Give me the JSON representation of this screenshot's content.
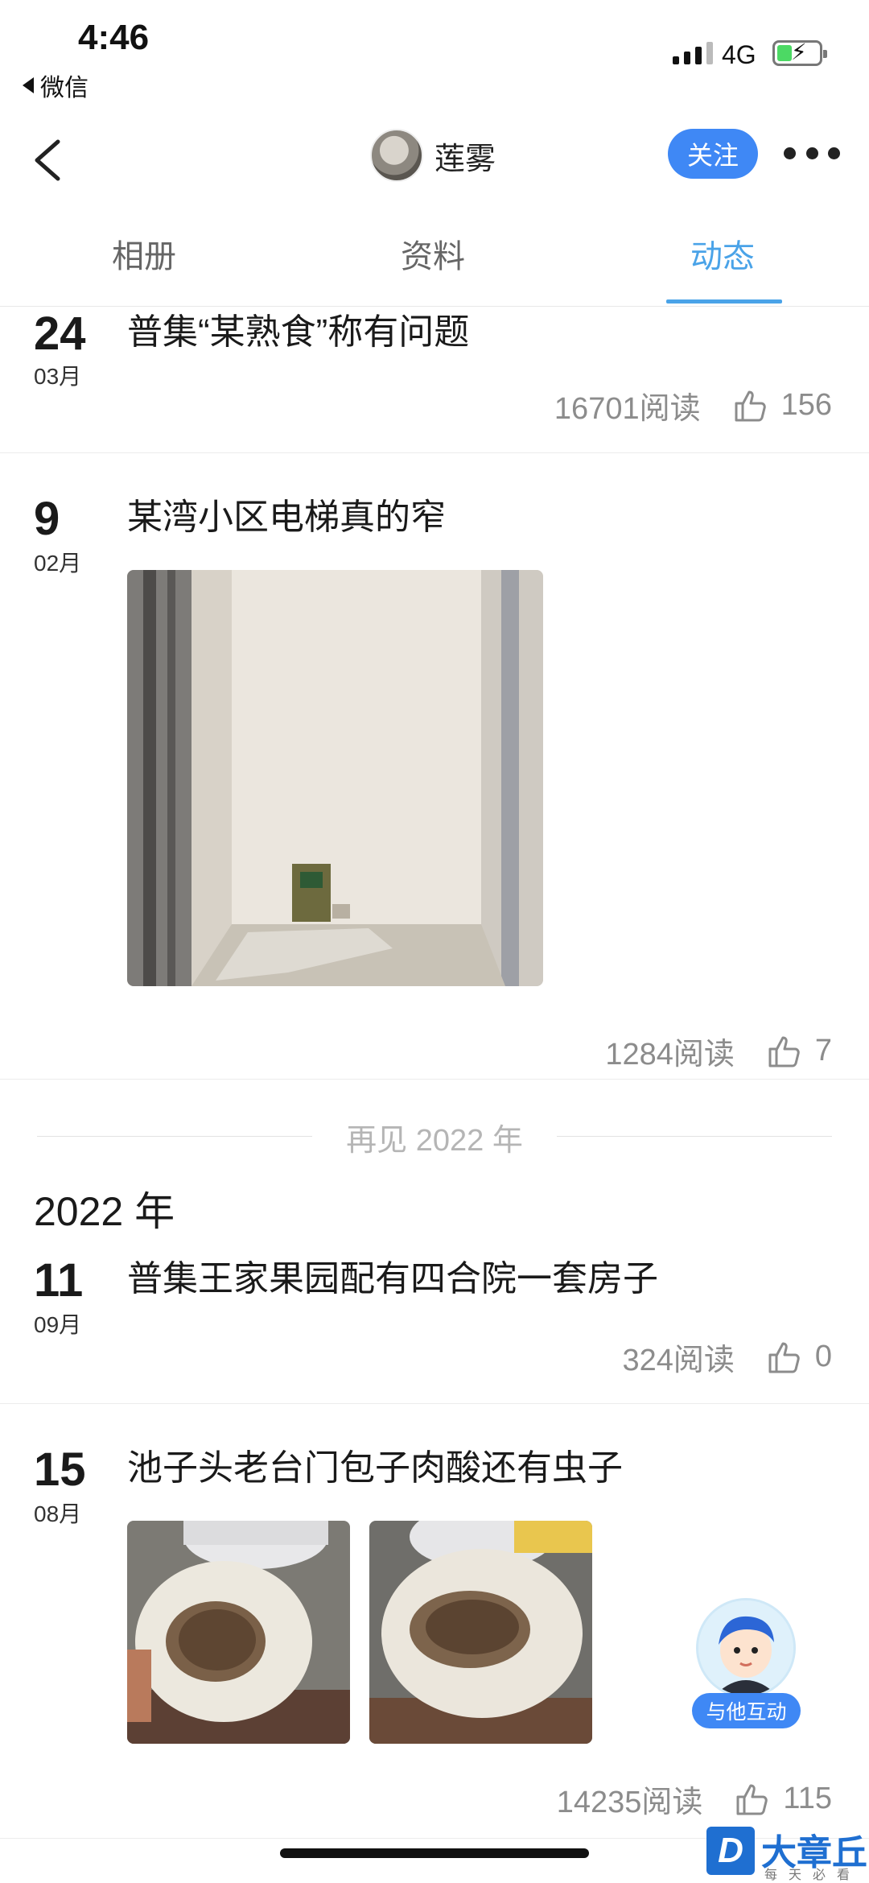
{
  "status_bar": {
    "time": "4:46",
    "back_app": "微信",
    "network": "4G"
  },
  "nav": {
    "nickname": "莲雾",
    "follow_label": "关注"
  },
  "tabs": [
    {
      "label": "相册"
    },
    {
      "label": "资料"
    },
    {
      "label": "动态",
      "active": true
    }
  ],
  "posts": [
    {
      "day": "24",
      "month": "03月",
      "title": "普集“某熟食”称有问题",
      "reads": "16701阅读",
      "likes": "156"
    },
    {
      "day": "9",
      "month": "02月",
      "title": "某湾小区电梯真的窄",
      "reads": "1284阅读",
      "likes": "7"
    },
    {
      "day": "11",
      "month": "09月",
      "title": "普集王家果园配有四合院一套房子",
      "reads": "324阅读",
      "likes": "0"
    },
    {
      "day": "15",
      "month": "08月",
      "title": "池子头老台门包子肉酸还有虫子",
      "reads": "14235阅读",
      "likes": "115"
    }
  ],
  "divider_label": "再见 2022 年",
  "year_header": "2022 年",
  "fab": {
    "label": "与他互动"
  },
  "watermark": {
    "title": "大章丘",
    "logo": "D",
    "sub": "每天必看"
  },
  "colors": {
    "accent": "#4aa3e8",
    "button": "#3f88f5",
    "muted": "#8c8c8c"
  }
}
